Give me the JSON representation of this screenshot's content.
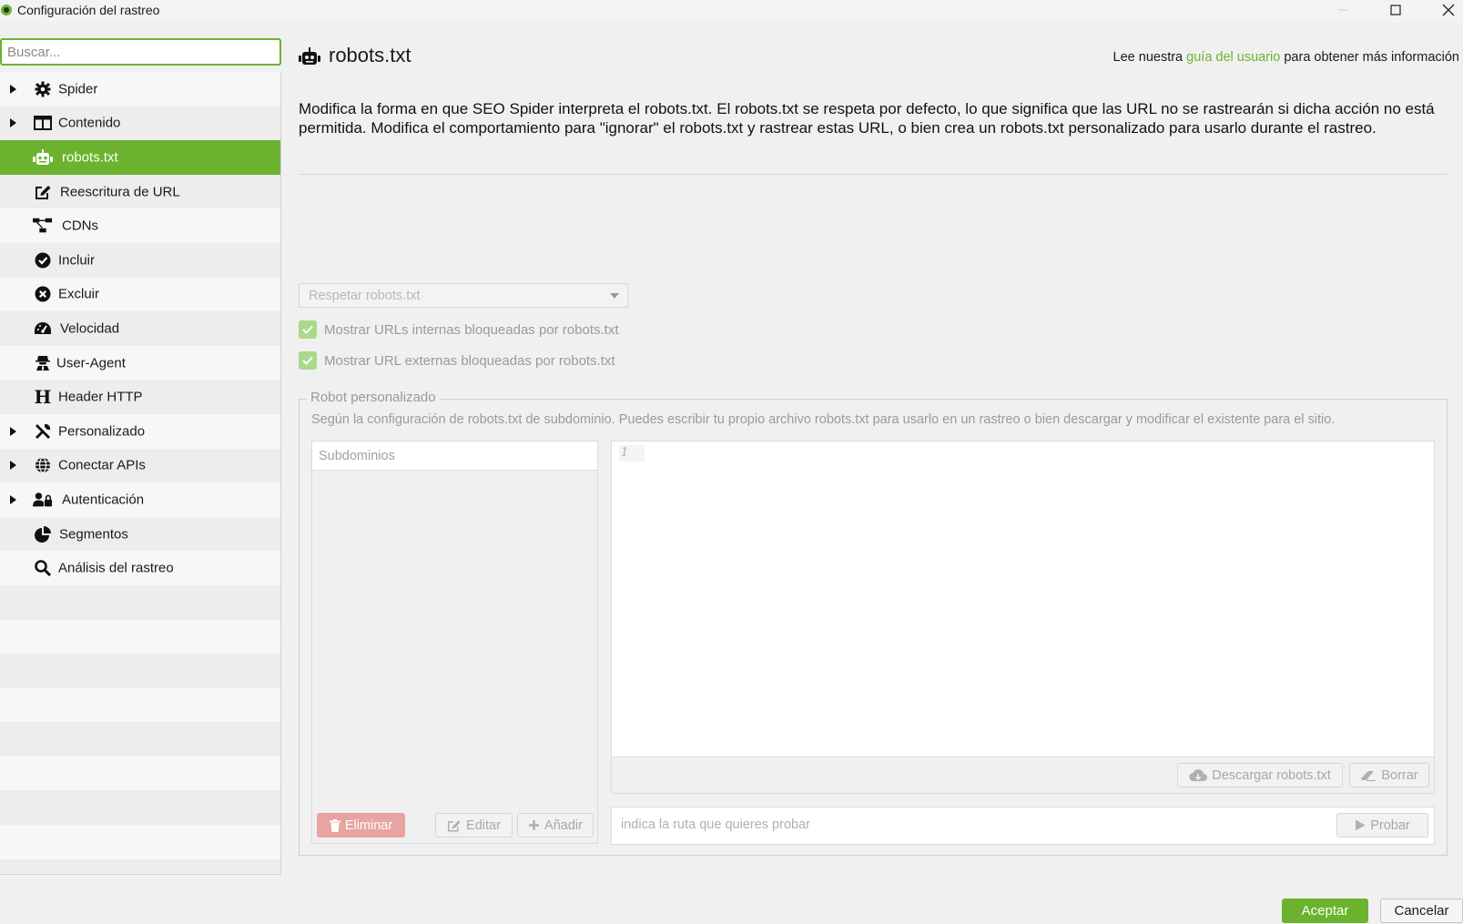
{
  "window": {
    "title": "Configuración del rastreo",
    "icon": "app-icon"
  },
  "sidebar": {
    "search_placeholder": "Buscar...",
    "items": [
      {
        "label": "Spider",
        "icon": "gear-icon",
        "expandable": true
      },
      {
        "label": "Contenido",
        "icon": "columns-icon",
        "expandable": true
      },
      {
        "label": "robots.txt",
        "icon": "robot-icon",
        "selected": true
      },
      {
        "label": "Reescritura de URL",
        "icon": "edit-icon"
      },
      {
        "label": "CDNs",
        "icon": "network-icon"
      },
      {
        "label": "Incluir",
        "icon": "check-circle-icon"
      },
      {
        "label": "Excluir",
        "icon": "x-circle-icon"
      },
      {
        "label": "Velocidad",
        "icon": "speedometer-icon"
      },
      {
        "label": "User-Agent",
        "icon": "user-secret-icon"
      },
      {
        "label": "Header HTTP",
        "icon": "header-icon"
      },
      {
        "label": "Personalizado",
        "icon": "tools-icon",
        "expandable": true
      },
      {
        "label": "Conectar APIs",
        "icon": "globe-icon",
        "expandable": true
      },
      {
        "label": "Autenticación",
        "icon": "user-lock-icon",
        "expandable": true
      },
      {
        "label": "Segmentos",
        "icon": "pie-chart-icon"
      },
      {
        "label": "Análisis del rastreo",
        "icon": "search-icon"
      }
    ]
  },
  "main": {
    "title": "robots.txt",
    "guide_prefix": "Lee nuestra ",
    "guide_link": "guía del usuario",
    "guide_suffix": " para obtener más información",
    "description": "Modifica la forma en que SEO Spider interpreta el robots.txt. El robots.txt se respeta por defecto, lo que significa que las URL no se rastrearán si dicha acción no está permitida. Modifica el comportamiento para \"ignorar\" el robots.txt y rastrear estas URL, o bien crea un robots.txt personalizado para usarlo durante el rastreo.",
    "mode_select": "Respetar robots.txt",
    "checkbox_internal": "Mostrar URLs internas bloqueadas por robots.txt",
    "checkbox_external": "Mostrar URL externas bloqueadas por robots.txt",
    "custom_robot": {
      "legend": "Robot personalizado",
      "description": "Según la configuración de robots.txt de subdominio. Puedes escribir tu propio archivo robots.txt para usarlo en un rastreo o bien descargar y modificar el existente para el sitio.",
      "subdomains_header": "Subdominios",
      "line_number": "1",
      "delete_label": "Eliminar",
      "edit_label": "Editar",
      "add_label": "Añadir",
      "download_label": "Descargar robots.txt",
      "clear_label": "Borrar",
      "test_placeholder": "indica la ruta que quieres probar",
      "test_label": "Probar"
    }
  },
  "footer": {
    "accept_label": "Aceptar",
    "cancel_label": "Cancelar"
  },
  "colors": {
    "accent": "#6bb32f",
    "delete": "#e8a3a3"
  }
}
